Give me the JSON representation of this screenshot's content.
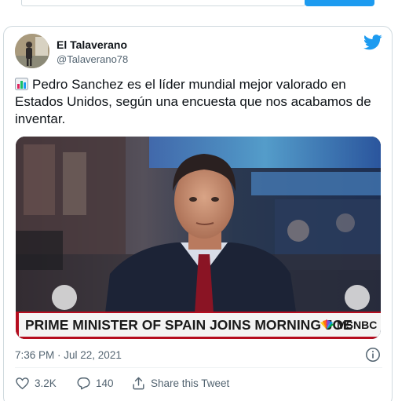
{
  "tweet": {
    "author_name": "El Talaverano",
    "author_handle": "@Talaverano78",
    "text": "Pedro Sanchez es el líder mundial mejor valorado en Estados Unidos, según una encuesta que nos acabamos de inventar.",
    "timestamp": "7:36 PM · Jul 22, 2021",
    "likes": "3.2K",
    "replies": "140",
    "share_label": "Share this Tweet"
  },
  "media": {
    "headline": "PRIME MINISTER OF SPAIN JOINS MORNING JOE",
    "network": "MSNBC"
  },
  "colors": {
    "twitter_blue": "#1d9bf0",
    "text_secondary": "#536471",
    "msnbc_red": "#b50d1f",
    "border": "#cfd9de"
  },
  "icons": [
    "twitter-bird-icon",
    "bar-chart-emoji-icon",
    "info-icon",
    "heart-icon",
    "reply-icon",
    "share-icon",
    "msnbc-peacock-icon"
  ]
}
